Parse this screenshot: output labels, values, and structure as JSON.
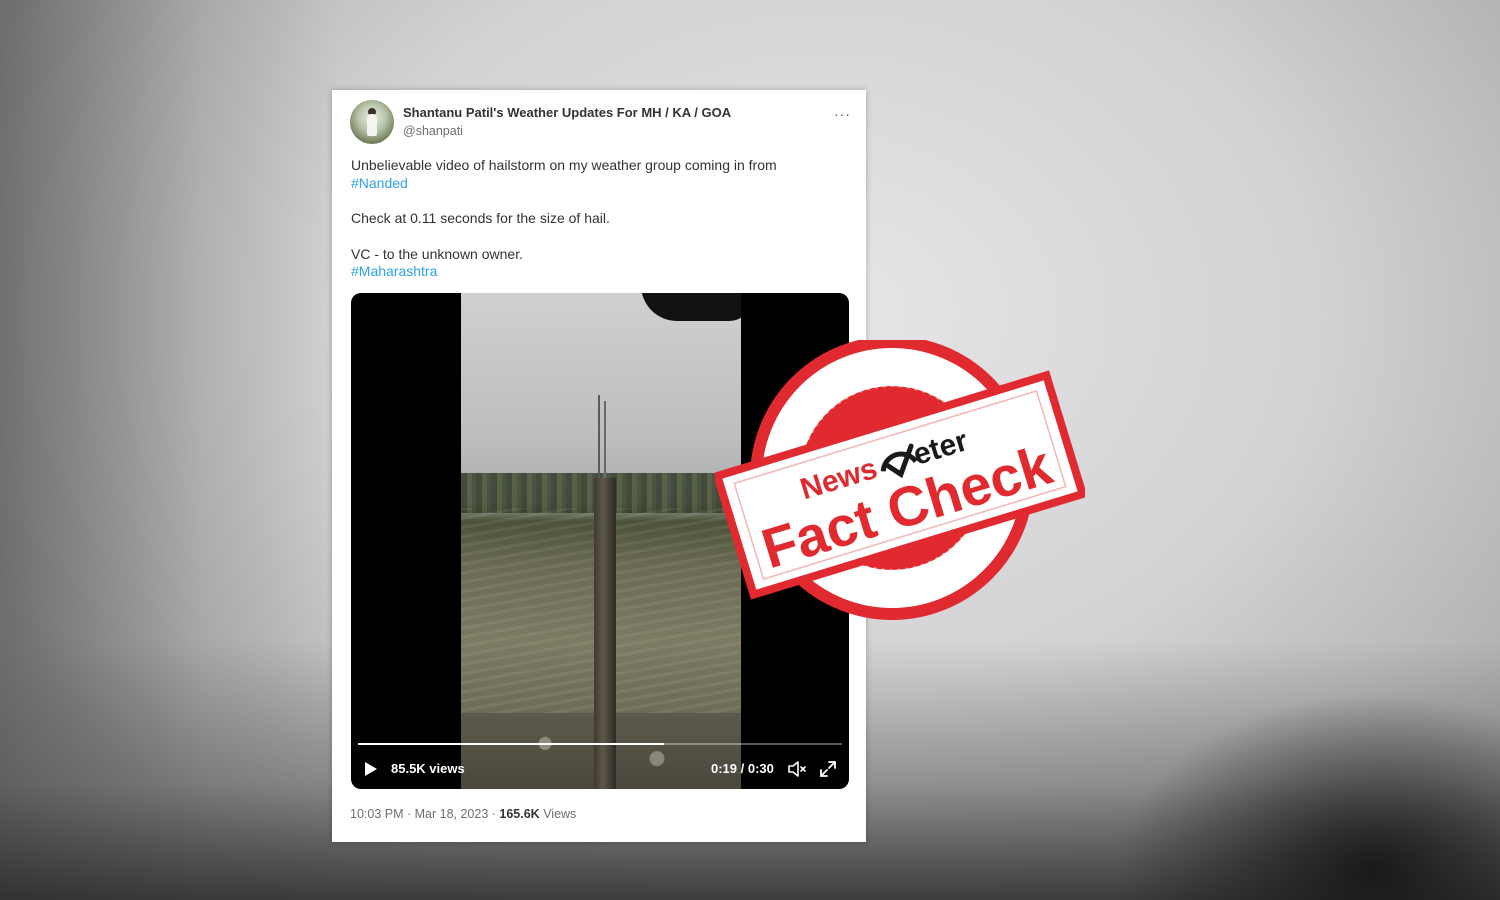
{
  "tweet": {
    "display_name": "Shantanu Patil's Weather Updates For MH / KA / GOA",
    "handle": "@shanpati",
    "more": "···",
    "text_line1": "Unbelievable video of hailstorm on my weather group coming in from",
    "hashtag1": "#Nanded",
    "text_line2": "Check at 0.11 seconds for the size of hail.",
    "text_line3": "VC - to the unknown owner.",
    "hashtag2": "#Maharashtra",
    "hashtag_color": "#2ea2e8"
  },
  "video": {
    "views": "85.5K views",
    "time": "0:19 / 0:30",
    "progress": 0.633
  },
  "footer": {
    "timestamp": "10:03 PM · Mar 18, 2023 ·",
    "view_count": "165.6K",
    "views_word": "Views"
  },
  "stamp": {
    "brand_news": "News",
    "brand_meter": "eter",
    "label": "Fact Check",
    "color": "#e02a2f"
  }
}
